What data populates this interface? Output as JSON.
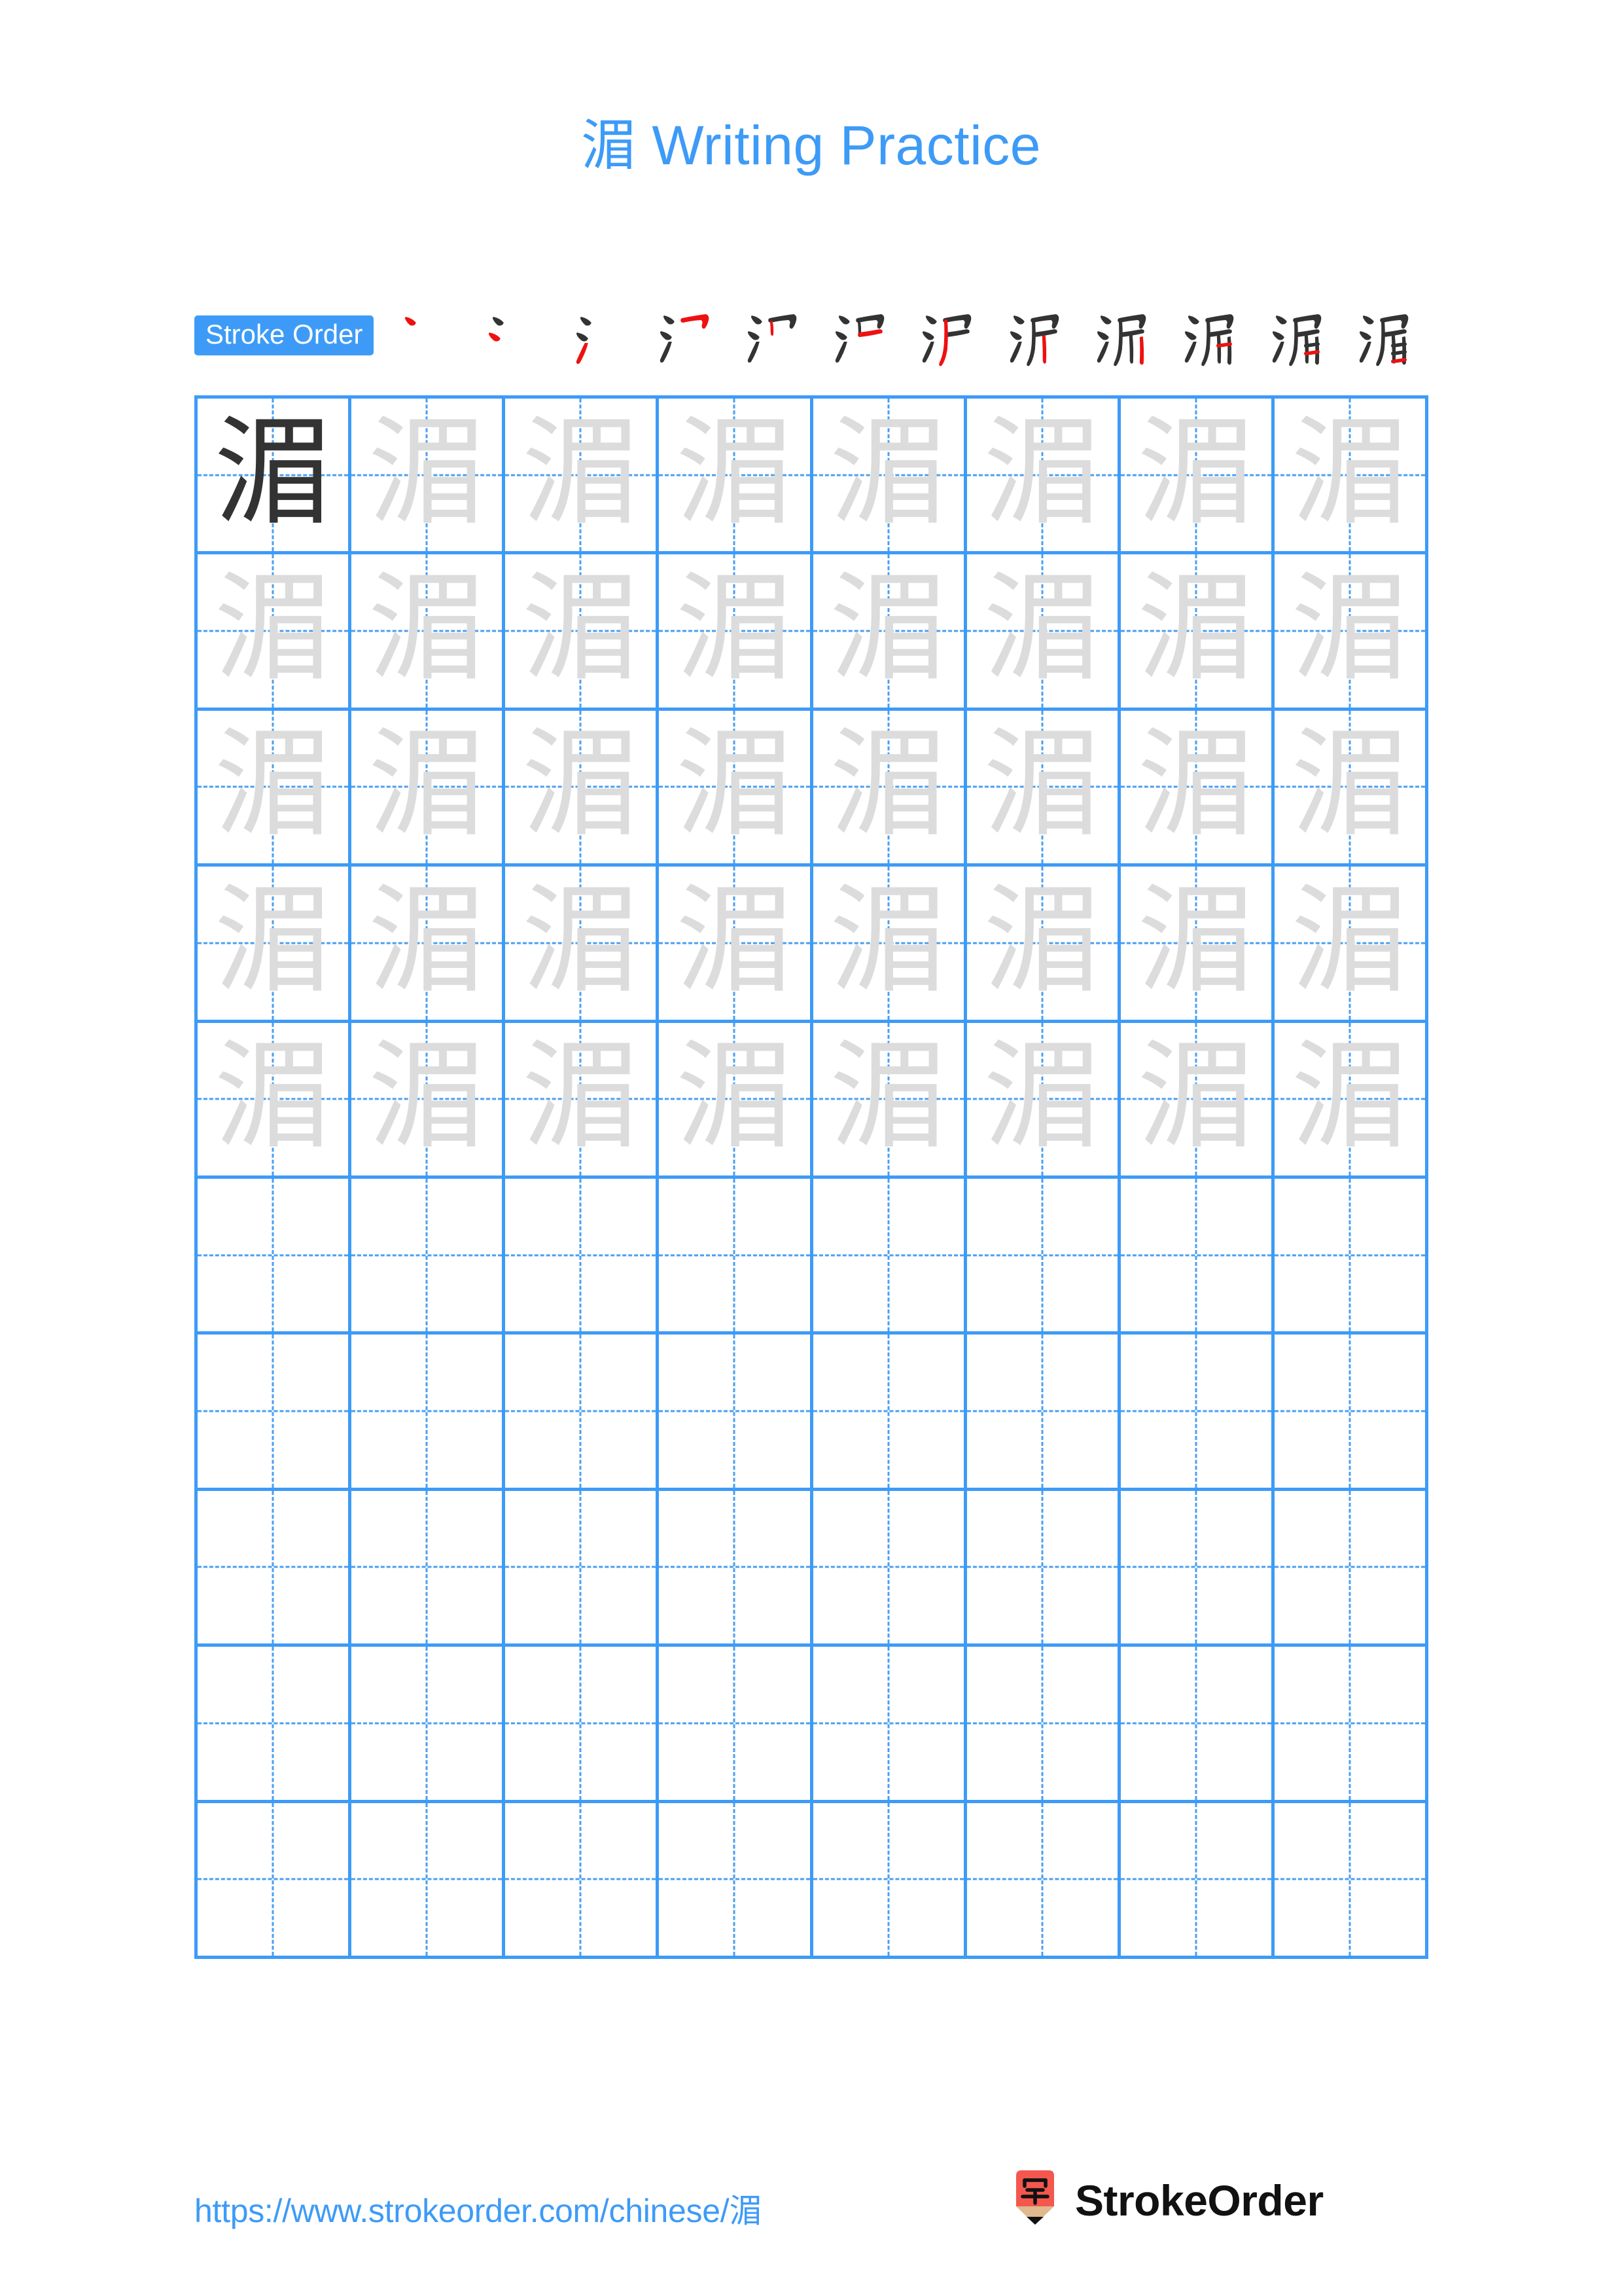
{
  "character": "湄",
  "page": {
    "title_prefix": "湄",
    "title_text": " Writing Practice",
    "background": "#ffffff",
    "accent_color": "#3d9bf7"
  },
  "stroke_order": {
    "label": "Stroke Order",
    "total_strokes": 12,
    "new_stroke_color": "#ee1111",
    "drawn_stroke_color": "#333333",
    "steps": [
      {
        "index": 1,
        "glyph": "丶"
      },
      {
        "index": 2,
        "glyph": "冫"
      },
      {
        "index": 3,
        "glyph": "氵"
      },
      {
        "index": 4,
        "glyph": "氵⺈"
      },
      {
        "index": 5,
        "glyph": "汙"
      },
      {
        "index": 6,
        "glyph": "沪"
      },
      {
        "index": 7,
        "glyph": "沪"
      },
      {
        "index": 8,
        "glyph": "沪"
      },
      {
        "index": 9,
        "glyph": "浘"
      },
      {
        "index": 10,
        "glyph": "湄"
      },
      {
        "index": 11,
        "glyph": "湄"
      },
      {
        "index": 12,
        "glyph": "湄"
      }
    ]
  },
  "grid": {
    "columns": 8,
    "rows": 10,
    "line_color": "#3d9bf7",
    "guide_color": "#4a9ff0",
    "model_char_color": "#333333",
    "trace_char_color": "#dcdcdc",
    "cells": [
      [
        "湄",
        "湄",
        "湄",
        "湄",
        "湄",
        "湄",
        "湄",
        "湄"
      ],
      [
        "湄",
        "湄",
        "湄",
        "湄",
        "湄",
        "湄",
        "湄",
        "湄"
      ],
      [
        "湄",
        "湄",
        "湄",
        "湄",
        "湄",
        "湄",
        "湄",
        "湄"
      ],
      [
        "湄",
        "湄",
        "湄",
        "湄",
        "湄",
        "湄",
        "湄",
        "湄"
      ],
      [
        "湄",
        "湄",
        "湄",
        "湄",
        "湄",
        "湄",
        "湄",
        "湄"
      ],
      [
        "",
        "",
        "",
        "",
        "",
        "",
        "",
        ""
      ],
      [
        "",
        "",
        "",
        "",
        "",
        "",
        "",
        ""
      ],
      [
        "",
        "",
        "",
        "",
        "",
        "",
        "",
        ""
      ],
      [
        "",
        "",
        "",
        "",
        "",
        "",
        "",
        ""
      ],
      [
        "",
        "",
        "",
        "",
        "",
        "",
        "",
        ""
      ]
    ],
    "cell_styles": [
      [
        "dark",
        "light",
        "light",
        "light",
        "light",
        "light",
        "light",
        "light"
      ],
      [
        "light",
        "light",
        "light",
        "light",
        "light",
        "light",
        "light",
        "light"
      ],
      [
        "light",
        "light",
        "light",
        "light",
        "light",
        "light",
        "light",
        "light"
      ],
      [
        "light",
        "light",
        "light",
        "light",
        "light",
        "light",
        "light",
        "light"
      ],
      [
        "light",
        "light",
        "light",
        "light",
        "light",
        "light",
        "light",
        "light"
      ],
      [
        "empty",
        "empty",
        "empty",
        "empty",
        "empty",
        "empty",
        "empty",
        "empty"
      ],
      [
        "empty",
        "empty",
        "empty",
        "empty",
        "empty",
        "empty",
        "empty",
        "empty"
      ],
      [
        "empty",
        "empty",
        "empty",
        "empty",
        "empty",
        "empty",
        "empty",
        "empty"
      ],
      [
        "empty",
        "empty",
        "empty",
        "empty",
        "empty",
        "empty",
        "empty",
        "empty"
      ],
      [
        "empty",
        "empty",
        "empty",
        "empty",
        "empty",
        "empty",
        "empty",
        "empty"
      ]
    ]
  },
  "footer": {
    "url": "https://www.strokeorder.com/chinese/湄",
    "brand_name": "StrokeOrder",
    "logo_char": "字",
    "logo_color": "#f4574e",
    "logo_tip_color": "#e0b98f"
  }
}
